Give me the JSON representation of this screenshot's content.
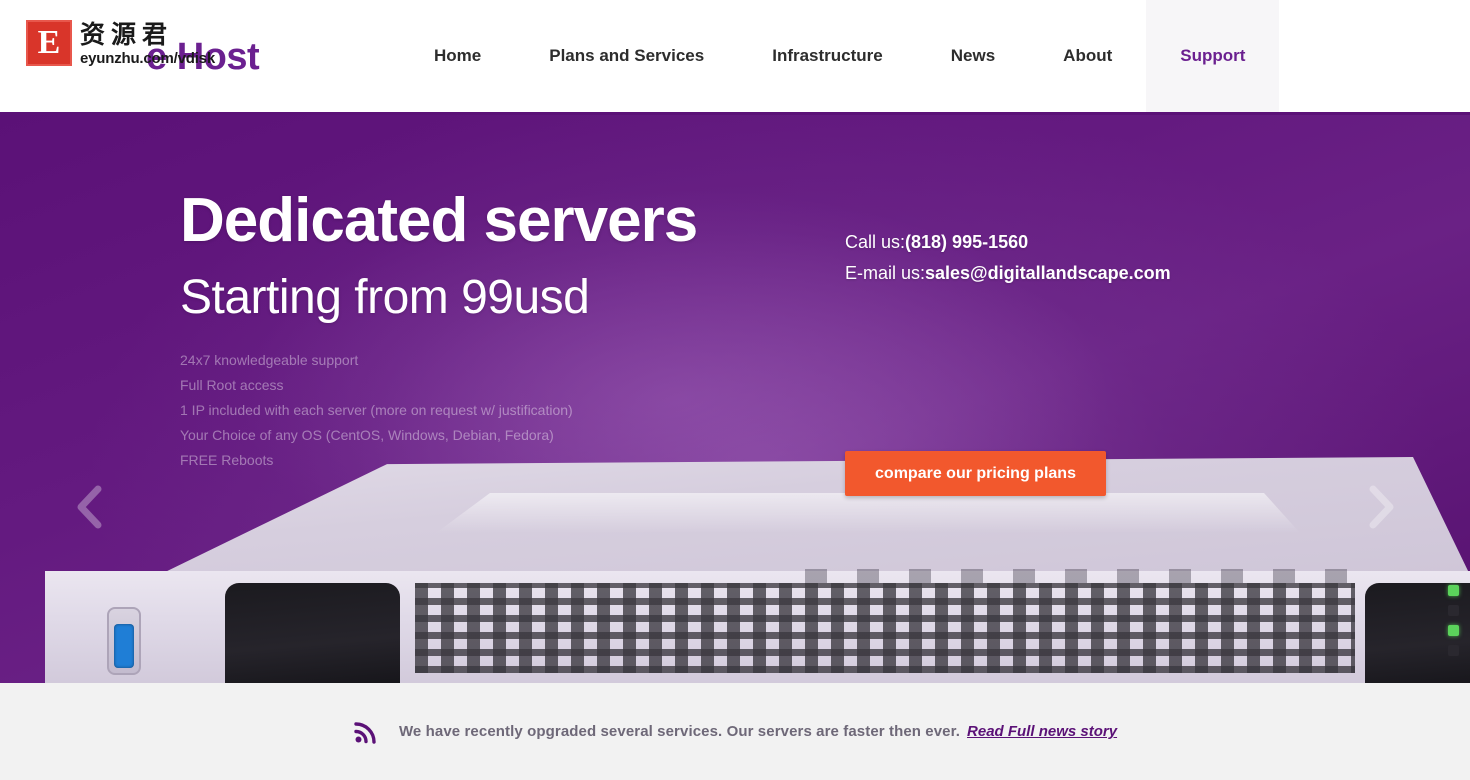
{
  "header": {
    "site_title": "e Host",
    "watermark": {
      "badge_letter": "E",
      "cn_text": "资源君",
      "url_text": "eyunzhu.com/vdisk"
    },
    "nav": [
      {
        "label": "Home",
        "active": false
      },
      {
        "label": "Plans and Services",
        "active": false
      },
      {
        "label": "Infrastructure",
        "active": false
      },
      {
        "label": "News",
        "active": false
      },
      {
        "label": "About",
        "active": false
      },
      {
        "label": "Support",
        "active": true
      }
    ]
  },
  "hero": {
    "heading": "Dedicated servers",
    "subheading": "Starting from 99usd",
    "features": [
      "24x7 knowledgeable support",
      "Full Root access",
      "1 IP included with each server (more on request w/ justification)",
      "Your Choice of any OS (CentOS, Windows, Debian, Fedora)",
      "FREE Reboots"
    ],
    "contact": {
      "phone_label": "Call us:",
      "phone_value": "(818) 995-1560",
      "email_label": "E-mail us:",
      "email_value": "sales@digitallandscape.com"
    },
    "cta_label": "compare our pricing plans",
    "prev_arrow": "chevron-left",
    "next_arrow": "chevron-right"
  },
  "newsbar": {
    "icon": "rss-icon",
    "text": "We have recently opgraded several services. Our servers are faster then ever.",
    "link_label": "Read Full news story"
  },
  "colors": {
    "brand_purple": "#6B2090",
    "hero_purple_dark": "#5B1177",
    "hero_purple_light": "#6B3180",
    "cta_orange": "#F2582D",
    "newsbar_bg": "#F2F2F2",
    "news_text": "#6E6878",
    "watermark_red": "#D9352A"
  }
}
